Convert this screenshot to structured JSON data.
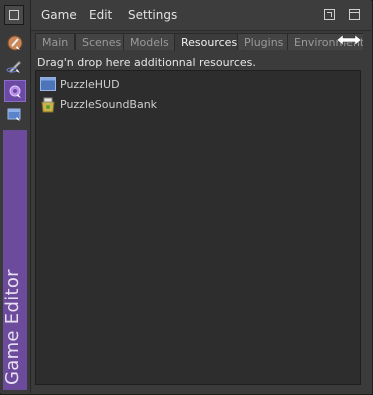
{
  "menu": {
    "items": [
      "Game",
      "Edit",
      "Settings"
    ]
  },
  "tabs": [
    {
      "label": "Main",
      "active": false
    },
    {
      "label": "Scenes",
      "active": false
    },
    {
      "label": "Models",
      "active": false
    },
    {
      "label": "Resources",
      "active": true
    },
    {
      "label": "Plugins",
      "active": false
    },
    {
      "label": "Environments",
      "active": false
    }
  ],
  "content": {
    "hint": "Drag'n drop here additionnal resources.",
    "resources": [
      {
        "name": "PuzzleHUD",
        "icon": "hud-window-icon"
      },
      {
        "name": "PuzzleSoundBank",
        "icon": "sound-bank-icon"
      }
    ]
  },
  "sidebar": {
    "title": "Game Editor",
    "tools": [
      "paint-brush-icon",
      "pen-tool-icon",
      "game-settings-icon",
      "hud-tool-icon"
    ]
  },
  "colors": {
    "accent": "#6c4b9c",
    "panel": "#2d2d2d"
  }
}
